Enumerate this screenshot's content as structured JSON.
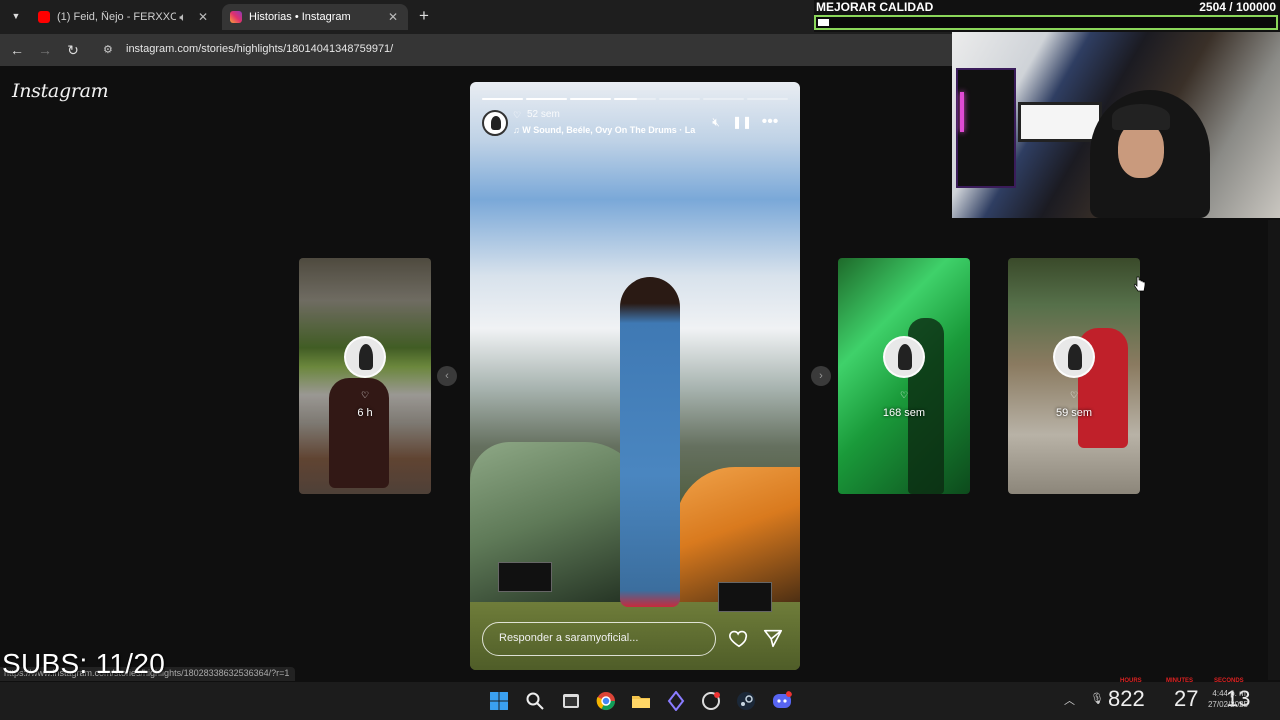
{
  "browser": {
    "tabs": [
      {
        "title": "(1) Feid, Ñejo - FERXXO X N",
        "favicon_color": "#ff0000",
        "active": false
      },
      {
        "title": "Historias • Instagram",
        "favicon_color": "#e1306c",
        "active": true
      }
    ],
    "url": "instagram.com/stories/highlights/18014041348759971/",
    "status_url": "https://www.instagram.com/stories/highlights/18028338632536364/?r=1"
  },
  "overlay": {
    "quality_label": "MEJORAR CALIDAD",
    "quality_count": "2504 / 100000",
    "quality_progress": 0.025,
    "subs_label": "SUBS: 11/20"
  },
  "page": {
    "logo": "Instagram"
  },
  "story": {
    "time": "52 sem",
    "music": "W Sound, Beéle, Ovy On The Drums · La",
    "progress_segments": [
      1,
      1,
      1,
      0.55,
      0,
      0,
      0
    ],
    "reply_placeholder": "Responder a saramyoficial..."
  },
  "side_stories": [
    {
      "time": "6 h"
    },
    {
      "time": "168 sem"
    },
    {
      "time": "59 sem"
    }
  ],
  "taskbar": {
    "clock_time": "4:44 p. m.",
    "clock_date": "27/02/2025",
    "counter_hours": "822",
    "counter_minutes": "27",
    "counter_seconds": "13",
    "counter_labels": [
      "HOURS",
      "MINUTES",
      "SECONDS"
    ]
  },
  "colors": {
    "accent_green": "#8bd75a",
    "background": "#0f0f0f"
  }
}
